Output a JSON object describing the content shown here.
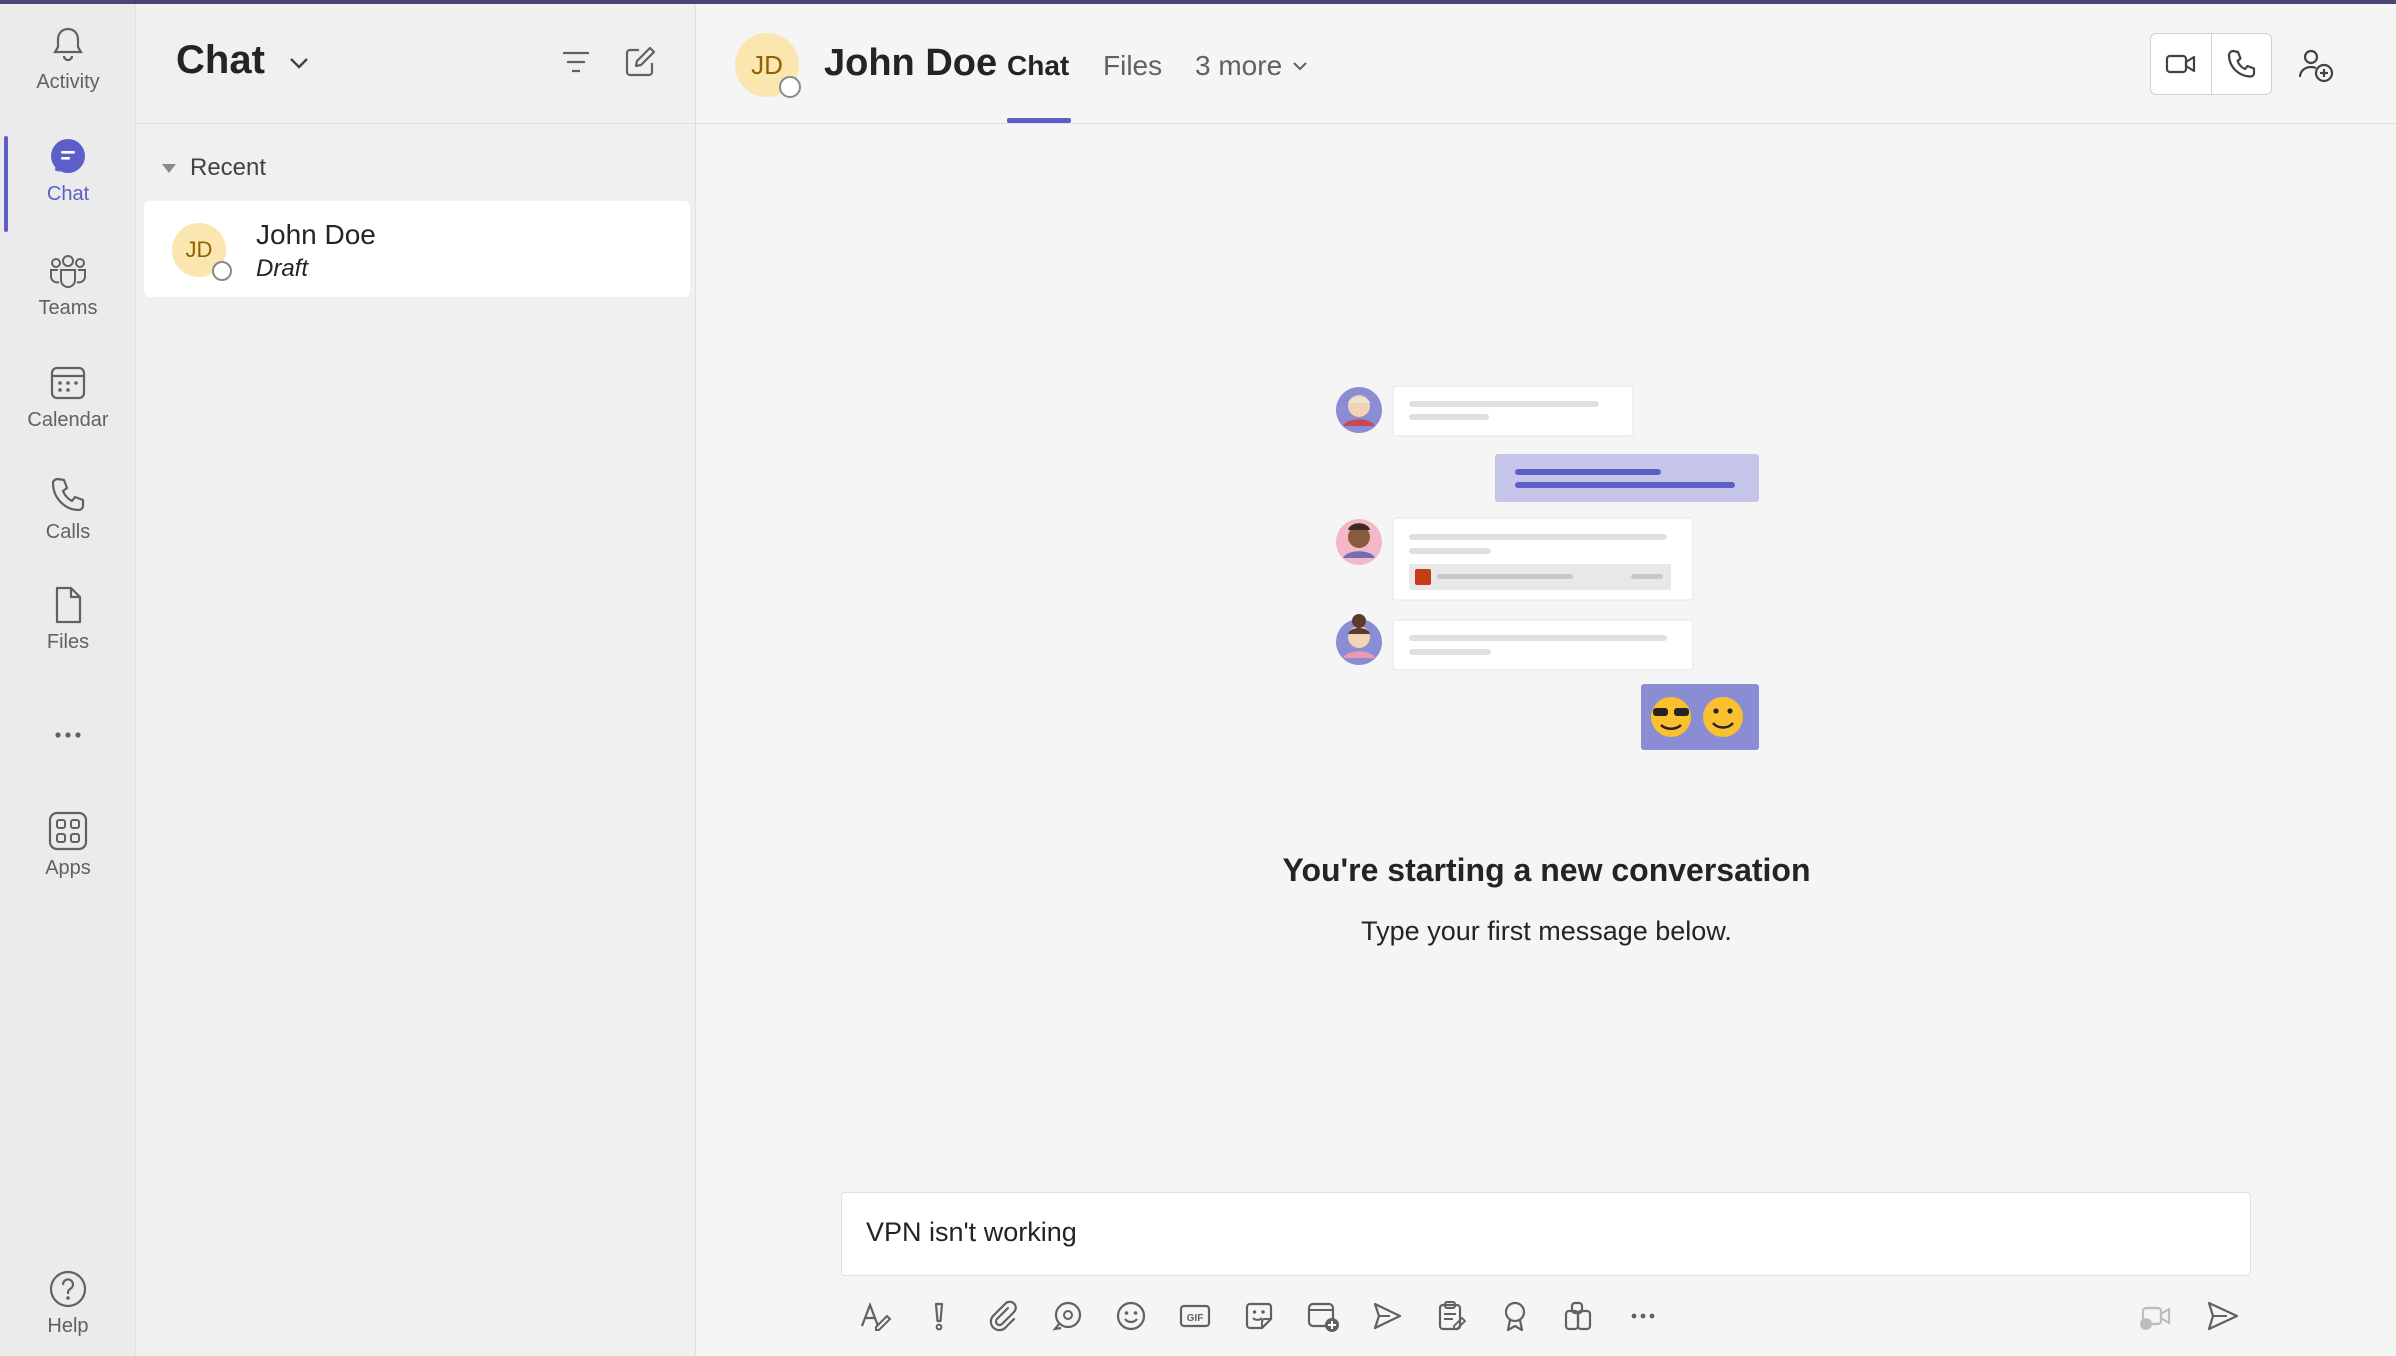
{
  "rail": {
    "items": [
      {
        "label": "Activity",
        "icon": "bell-icon"
      },
      {
        "label": "Chat",
        "icon": "chat-icon",
        "active": true
      },
      {
        "label": "Teams",
        "icon": "teams-icon"
      },
      {
        "label": "Calendar",
        "icon": "calendar-icon"
      },
      {
        "label": "Calls",
        "icon": "phone-icon"
      },
      {
        "label": "Files",
        "icon": "file-icon"
      },
      {
        "label": "",
        "icon": "more-icon"
      },
      {
        "label": "Apps",
        "icon": "apps-icon"
      }
    ],
    "help_label": "Help"
  },
  "list": {
    "title": "Chat",
    "section": "Recent",
    "items": [
      {
        "initials": "JD",
        "name": "John Doe",
        "preview": "Draft"
      }
    ]
  },
  "conversation": {
    "initials": "JD",
    "name": "John Doe",
    "tabs": [
      "Chat",
      "Files",
      "3 more"
    ],
    "empty_title": "You're starting a new conversation",
    "empty_subtitle": "Type your first message below."
  },
  "composer": {
    "value": "VPN isn't working"
  },
  "colors": {
    "accent": "#5b5fc7",
    "avatar_bg": "#fbe6b0",
    "avatar_text": "#8f6200",
    "top_strip": "#464775"
  }
}
